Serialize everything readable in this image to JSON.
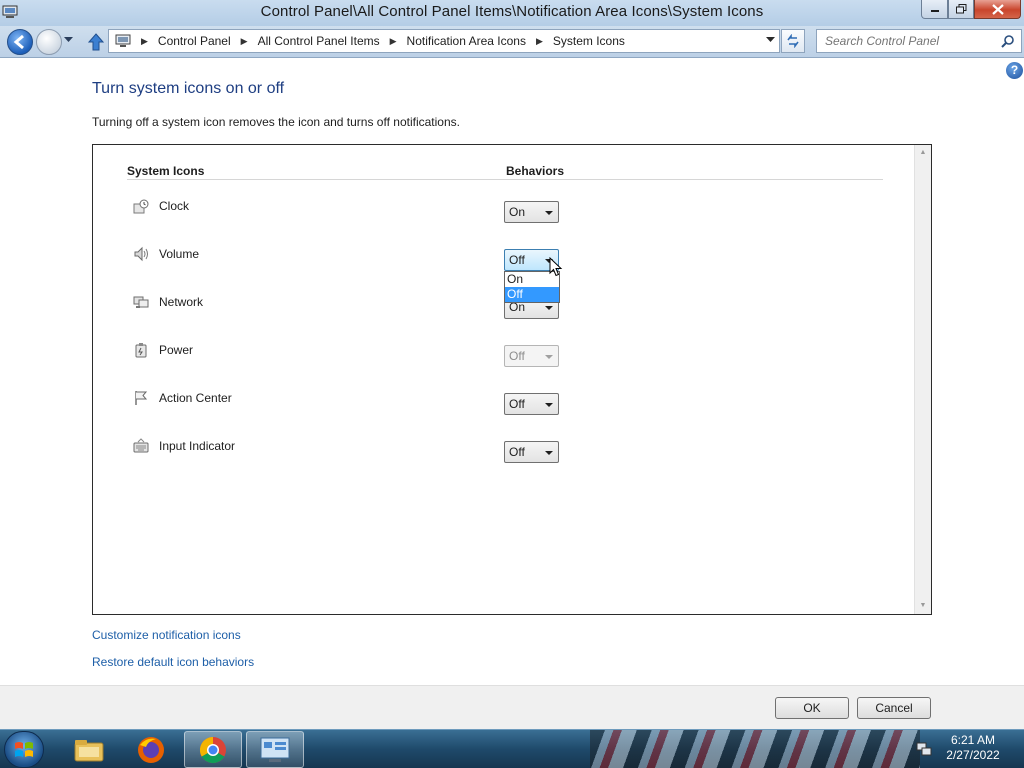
{
  "window": {
    "title": "Control Panel\\All Control Panel Items\\Notification Area Icons\\System Icons"
  },
  "address": {
    "breadcrumbs": [
      "Control Panel",
      "All Control Panel Items",
      "Notification Area Icons",
      "System Icons"
    ],
    "search_placeholder": "Search Control Panel"
  },
  "page": {
    "heading": "Turn system icons on or off",
    "description": "Turning off a system icon removes the icon and turns off notifications.",
    "columns": {
      "icons": "System Icons",
      "behaviors": "Behaviors"
    },
    "rows": [
      {
        "name": "Clock",
        "icon": "clock-icon",
        "value": "On",
        "state": "normal"
      },
      {
        "name": "Volume",
        "icon": "speaker-icon",
        "value": "Off",
        "state": "active"
      },
      {
        "name": "Network",
        "icon": "network-icon",
        "value": "On",
        "state": "normal"
      },
      {
        "name": "Power",
        "icon": "power-icon",
        "value": "Off",
        "state": "disabled"
      },
      {
        "name": "Action Center",
        "icon": "flag-icon",
        "value": "Off",
        "state": "normal"
      },
      {
        "name": "Input Indicator",
        "icon": "keyboard-icon",
        "value": "Off",
        "state": "normal"
      }
    ],
    "dropdown": {
      "options": [
        "On",
        "Off"
      ],
      "highlighted": "Off"
    },
    "links": {
      "customize": "Customize notification icons",
      "restore": "Restore default icon behaviors"
    }
  },
  "footer": {
    "ok": "OK",
    "cancel": "Cancel"
  },
  "taskbar": {
    "items": [
      "start-orb",
      "file-explorer-icon",
      "firefox-icon",
      "chrome-icon",
      "control-panel-icon"
    ],
    "time": "6:21 AM",
    "date": "2/27/2022"
  },
  "colors": {
    "heading": "#1e3e82",
    "link": "#1e5fa8",
    "selection": "#3399ff"
  }
}
